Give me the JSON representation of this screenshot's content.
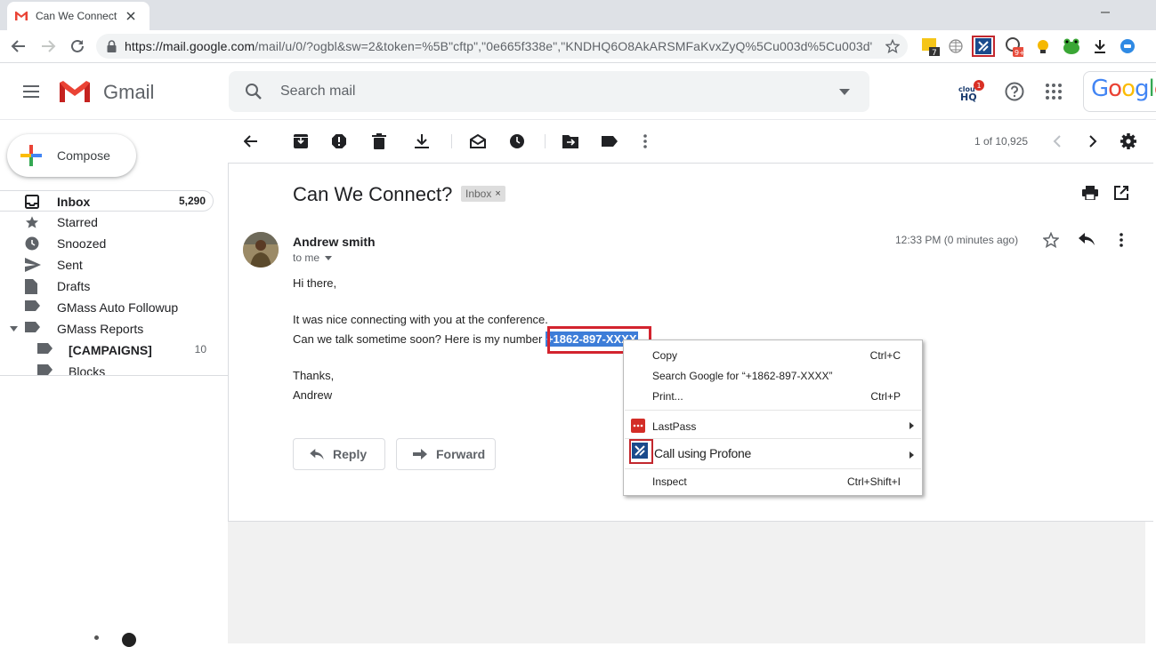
{
  "browser": {
    "tab_title": "Can We Connect?",
    "url_main": "https://mail.google.com",
    "url_rest": "/mail/u/0/?ogbl&sw=2&token=%5B\"cftp\",\"0e665f338e\",\"KNDHQ6O8AkARSMFaKvxZyQ%5Cu003d%5Cu003d\"...",
    "ext_badge_1": "7",
    "ext_badge_2": "9+"
  },
  "gmail": {
    "app_name": "Gmail",
    "search_placeholder": "Search mail",
    "cloudhq_label": "cloud HQ",
    "cloudhq_badge": "1",
    "google_logo": "Google"
  },
  "sidebar": {
    "compose_label": "Compose",
    "items": [
      {
        "label": "Inbox",
        "count": "5,290",
        "icon": "inbox-icon"
      },
      {
        "label": "Starred",
        "count": "",
        "icon": "star-icon"
      },
      {
        "label": "Snoozed",
        "count": "",
        "icon": "clock-icon"
      },
      {
        "label": "Sent",
        "count": "",
        "icon": "send-icon"
      },
      {
        "label": "Drafts",
        "count": "",
        "icon": "draft-icon"
      },
      {
        "label": "GMass Auto Followup",
        "count": "",
        "icon": "label-icon"
      },
      {
        "label": "GMass Reports",
        "count": "",
        "icon": "label-icon"
      },
      {
        "label": "[CAMPAIGNS]",
        "count": "10",
        "icon": "label-icon"
      },
      {
        "label": "Blocks",
        "count": "",
        "icon": "label-icon"
      }
    ]
  },
  "toolbar": {
    "pager": "1 of 10,925"
  },
  "email": {
    "subject": "Can We Connect?",
    "label_chip": "Inbox",
    "label_chip_x": "×",
    "sender": "Andrew smith",
    "to": "to me",
    "timestamp": "12:33 PM (0 minutes ago)",
    "greeting": "Hi there,",
    "line1": "It was nice connecting with you at the conference.",
    "line2_prefix": "Can we talk sometime soon? Here is my number ",
    "phone": "+1862-897-XXXX",
    "signoff": "Thanks,",
    "signature": "Andrew",
    "reply_label": "Reply",
    "forward_label": "Forward"
  },
  "context_menu": {
    "copy": "Copy",
    "copy_key": "Ctrl+C",
    "search": "Search Google for “+1862-897-XXXX”",
    "print": "Print...",
    "print_key": "Ctrl+P",
    "lastpass": "LastPass",
    "profone": "Call using Profone",
    "inspect": "Inspect",
    "inspect_key": "Ctrl+Shift+I"
  },
  "colors": {
    "highlight_box": "#d3232e",
    "selection": "#3d7dd8",
    "gmail_red": "#ea4335"
  }
}
